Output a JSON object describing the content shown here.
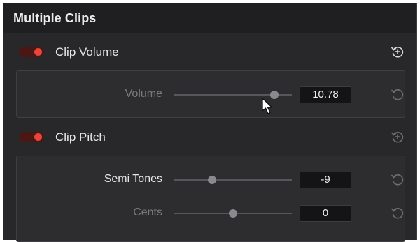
{
  "header": {
    "title": "Multiple Clips"
  },
  "clip_volume": {
    "label": "Clip Volume",
    "enabled": true,
    "params": [
      {
        "label": "Volume",
        "value": "10.78",
        "slider_level": 0.85
      }
    ]
  },
  "clip_pitch": {
    "label": "Clip Pitch",
    "enabled": true,
    "params": [
      {
        "label": "Semi Tones",
        "value": "-9",
        "slider_level": 0.32
      },
      {
        "label": "Cents",
        "value": "0",
        "slider_level": 0.5
      }
    ]
  },
  "colors": {
    "toggle_on": "#e8463a",
    "panel_bg": "#2d2d30",
    "value_bg": "#141416"
  },
  "icons": {
    "section_reset": "reset-all-icon",
    "param_reset": "reset-icon",
    "cursor": "mouse-cursor-icon"
  }
}
